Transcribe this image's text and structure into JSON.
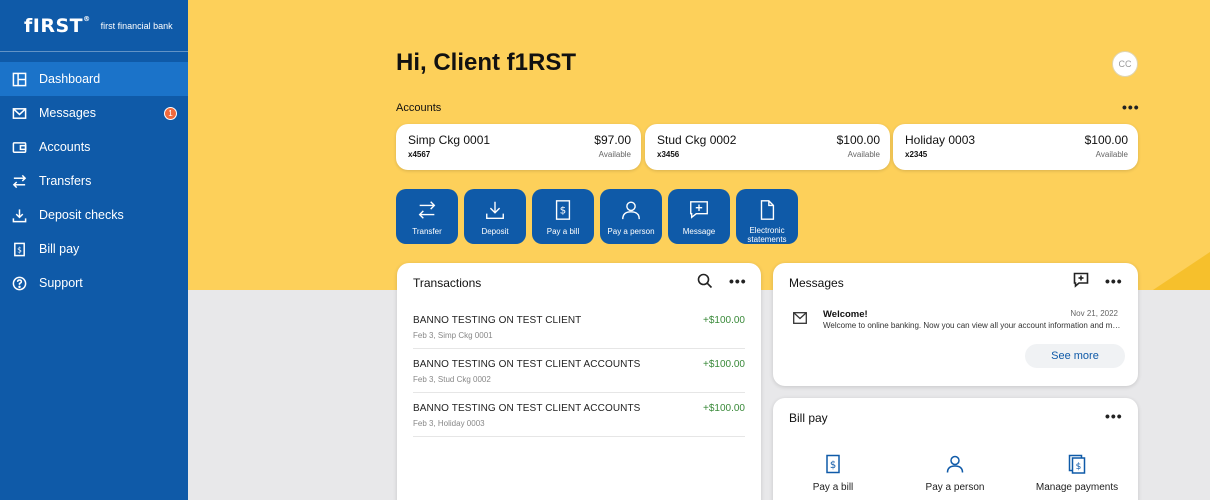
{
  "brand": {
    "logo": "fIRST",
    "logo_mark": "®",
    "subtitle": "first financial bank"
  },
  "sidebar": {
    "items": [
      {
        "label": "Dashboard",
        "icon": "dashboard-icon",
        "active": true
      },
      {
        "label": "Messages",
        "icon": "mail-icon",
        "badge": "1"
      },
      {
        "label": "Accounts",
        "icon": "wallet-icon"
      },
      {
        "label": "Transfers",
        "icon": "transfer-icon"
      },
      {
        "label": "Deposit checks",
        "icon": "download-icon"
      },
      {
        "label": "Bill pay",
        "icon": "bill-icon"
      },
      {
        "label": "Support",
        "icon": "help-icon"
      }
    ]
  },
  "header": {
    "greeting": "Hi, Client f1RST",
    "avatar_initials": "CC"
  },
  "accounts": {
    "label": "Accounts",
    "items": [
      {
        "name": "Simp Ckg 0001",
        "number": "x4567",
        "balance": "$97.00",
        "status": "Available"
      },
      {
        "name": "Stud Ckg 0002",
        "number": "x3456",
        "balance": "$100.00",
        "status": "Available"
      },
      {
        "name": "Holiday 0003",
        "number": "x2345",
        "balance": "$100.00",
        "status": "Available"
      }
    ]
  },
  "quick_actions": [
    {
      "label": "Transfer",
      "icon": "transfer-icon"
    },
    {
      "label": "Deposit",
      "icon": "download-icon"
    },
    {
      "label": "Pay a bill",
      "icon": "bill-icon"
    },
    {
      "label": "Pay a person",
      "icon": "person-icon"
    },
    {
      "label": "Message",
      "icon": "message-add-icon"
    },
    {
      "label": "Electronic statements",
      "icon": "document-icon"
    }
  ],
  "transactions": {
    "title": "Transactions",
    "items": [
      {
        "description": "BANNO TESTING ON TEST CLIENT",
        "sub": "Feb 3, Simp Ckg 0001",
        "amount": "+$100.00"
      },
      {
        "description": "BANNO TESTING ON TEST CLIENT ACCOUNTS",
        "sub": "Feb 3, Stud Ckg 0002",
        "amount": "+$100.00"
      },
      {
        "description": "BANNO TESTING ON TEST CLIENT ACCOUNTS",
        "sub": "Feb 3, Holiday 0003",
        "amount": "+$100.00"
      }
    ]
  },
  "messages": {
    "title": "Messages",
    "item": {
      "title": "Welcome!",
      "text": "Welcome to online banking. Now you can view all your account information and more",
      "date": "Nov 21, 2022"
    },
    "see_more": "See more"
  },
  "bill_pay": {
    "title": "Bill pay",
    "items": [
      {
        "label": "Pay a bill",
        "icon": "bill-icon"
      },
      {
        "label": "Pay a person",
        "icon": "person-icon"
      },
      {
        "label": "Manage payments",
        "icon": "receipts-icon"
      }
    ]
  },
  "more_label": "•••",
  "colors": {
    "brand_blue": "#0f5aa8",
    "hero_yellow": "#fdd05a",
    "positive_green": "#3a8a3a",
    "badge_orange": "#f26a3d"
  }
}
